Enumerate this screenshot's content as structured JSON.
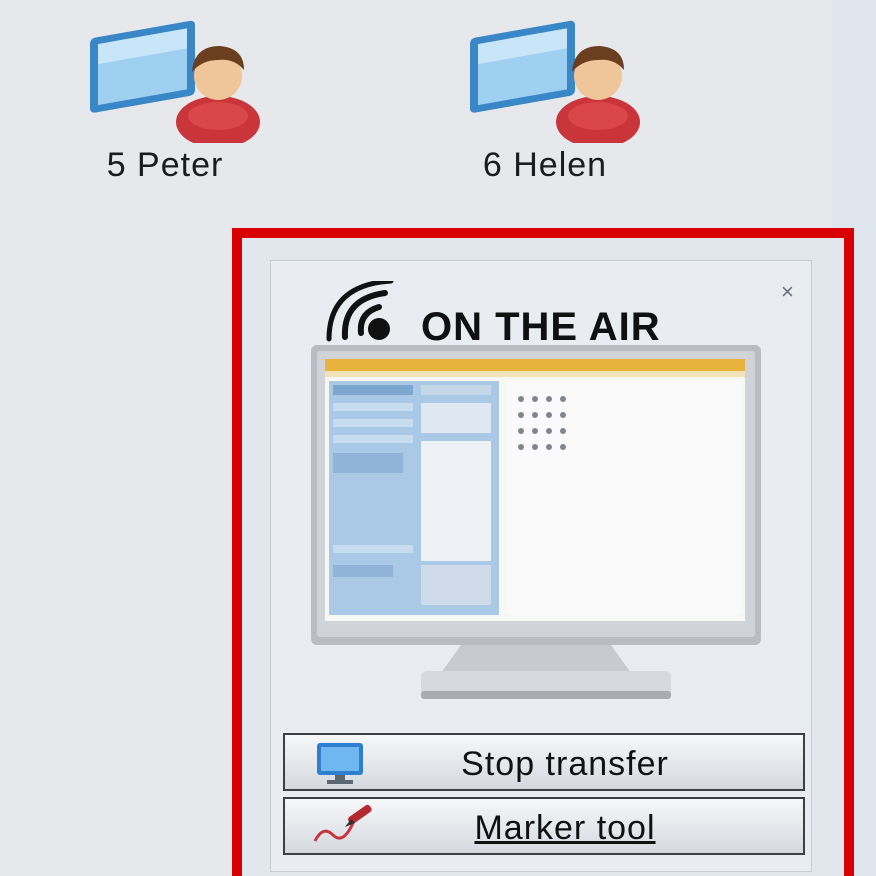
{
  "users": [
    {
      "label": "5 Peter",
      "icon": "user-monitor-icon"
    },
    {
      "label": "6 Helen",
      "icon": "user-monitor-icon"
    }
  ],
  "onair_panel": {
    "title": "ON THE AIR",
    "close_label": "×",
    "broadcast_icon": "broadcast-icon",
    "preview_icon": "monitor-preview-icon",
    "frame_color": "#d80000",
    "buttons": {
      "stop_transfer": {
        "label": "Stop transfer",
        "icon": "screen-transfer-icon"
      },
      "marker_tool": {
        "label": "Marker tool",
        "icon": "marker-pen-icon"
      }
    }
  }
}
